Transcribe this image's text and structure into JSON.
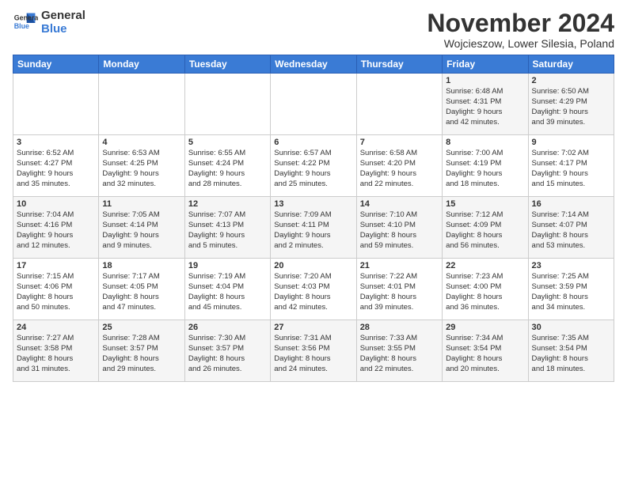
{
  "logo": {
    "line1": "General",
    "line2": "Blue"
  },
  "title": "November 2024",
  "location": "Wojcieszow, Lower Silesia, Poland",
  "days_of_week": [
    "Sunday",
    "Monday",
    "Tuesday",
    "Wednesday",
    "Thursday",
    "Friday",
    "Saturday"
  ],
  "weeks": [
    [
      {
        "day": "",
        "info": ""
      },
      {
        "day": "",
        "info": ""
      },
      {
        "day": "",
        "info": ""
      },
      {
        "day": "",
        "info": ""
      },
      {
        "day": "",
        "info": ""
      },
      {
        "day": "1",
        "info": "Sunrise: 6:48 AM\nSunset: 4:31 PM\nDaylight: 9 hours\nand 42 minutes."
      },
      {
        "day": "2",
        "info": "Sunrise: 6:50 AM\nSunset: 4:29 PM\nDaylight: 9 hours\nand 39 minutes."
      }
    ],
    [
      {
        "day": "3",
        "info": "Sunrise: 6:52 AM\nSunset: 4:27 PM\nDaylight: 9 hours\nand 35 minutes."
      },
      {
        "day": "4",
        "info": "Sunrise: 6:53 AM\nSunset: 4:25 PM\nDaylight: 9 hours\nand 32 minutes."
      },
      {
        "day": "5",
        "info": "Sunrise: 6:55 AM\nSunset: 4:24 PM\nDaylight: 9 hours\nand 28 minutes."
      },
      {
        "day": "6",
        "info": "Sunrise: 6:57 AM\nSunset: 4:22 PM\nDaylight: 9 hours\nand 25 minutes."
      },
      {
        "day": "7",
        "info": "Sunrise: 6:58 AM\nSunset: 4:20 PM\nDaylight: 9 hours\nand 22 minutes."
      },
      {
        "day": "8",
        "info": "Sunrise: 7:00 AM\nSunset: 4:19 PM\nDaylight: 9 hours\nand 18 minutes."
      },
      {
        "day": "9",
        "info": "Sunrise: 7:02 AM\nSunset: 4:17 PM\nDaylight: 9 hours\nand 15 minutes."
      }
    ],
    [
      {
        "day": "10",
        "info": "Sunrise: 7:04 AM\nSunset: 4:16 PM\nDaylight: 9 hours\nand 12 minutes."
      },
      {
        "day": "11",
        "info": "Sunrise: 7:05 AM\nSunset: 4:14 PM\nDaylight: 9 hours\nand 9 minutes."
      },
      {
        "day": "12",
        "info": "Sunrise: 7:07 AM\nSunset: 4:13 PM\nDaylight: 9 hours\nand 5 minutes."
      },
      {
        "day": "13",
        "info": "Sunrise: 7:09 AM\nSunset: 4:11 PM\nDaylight: 9 hours\nand 2 minutes."
      },
      {
        "day": "14",
        "info": "Sunrise: 7:10 AM\nSunset: 4:10 PM\nDaylight: 8 hours\nand 59 minutes."
      },
      {
        "day": "15",
        "info": "Sunrise: 7:12 AM\nSunset: 4:09 PM\nDaylight: 8 hours\nand 56 minutes."
      },
      {
        "day": "16",
        "info": "Sunrise: 7:14 AM\nSunset: 4:07 PM\nDaylight: 8 hours\nand 53 minutes."
      }
    ],
    [
      {
        "day": "17",
        "info": "Sunrise: 7:15 AM\nSunset: 4:06 PM\nDaylight: 8 hours\nand 50 minutes."
      },
      {
        "day": "18",
        "info": "Sunrise: 7:17 AM\nSunset: 4:05 PM\nDaylight: 8 hours\nand 47 minutes."
      },
      {
        "day": "19",
        "info": "Sunrise: 7:19 AM\nSunset: 4:04 PM\nDaylight: 8 hours\nand 45 minutes."
      },
      {
        "day": "20",
        "info": "Sunrise: 7:20 AM\nSunset: 4:03 PM\nDaylight: 8 hours\nand 42 minutes."
      },
      {
        "day": "21",
        "info": "Sunrise: 7:22 AM\nSunset: 4:01 PM\nDaylight: 8 hours\nand 39 minutes."
      },
      {
        "day": "22",
        "info": "Sunrise: 7:23 AM\nSunset: 4:00 PM\nDaylight: 8 hours\nand 36 minutes."
      },
      {
        "day": "23",
        "info": "Sunrise: 7:25 AM\nSunset: 3:59 PM\nDaylight: 8 hours\nand 34 minutes."
      }
    ],
    [
      {
        "day": "24",
        "info": "Sunrise: 7:27 AM\nSunset: 3:58 PM\nDaylight: 8 hours\nand 31 minutes."
      },
      {
        "day": "25",
        "info": "Sunrise: 7:28 AM\nSunset: 3:57 PM\nDaylight: 8 hours\nand 29 minutes."
      },
      {
        "day": "26",
        "info": "Sunrise: 7:30 AM\nSunset: 3:57 PM\nDaylight: 8 hours\nand 26 minutes."
      },
      {
        "day": "27",
        "info": "Sunrise: 7:31 AM\nSunset: 3:56 PM\nDaylight: 8 hours\nand 24 minutes."
      },
      {
        "day": "28",
        "info": "Sunrise: 7:33 AM\nSunset: 3:55 PM\nDaylight: 8 hours\nand 22 minutes."
      },
      {
        "day": "29",
        "info": "Sunrise: 7:34 AM\nSunset: 3:54 PM\nDaylight: 8 hours\nand 20 minutes."
      },
      {
        "day": "30",
        "info": "Sunrise: 7:35 AM\nSunset: 3:54 PM\nDaylight: 8 hours\nand 18 minutes."
      }
    ]
  ]
}
